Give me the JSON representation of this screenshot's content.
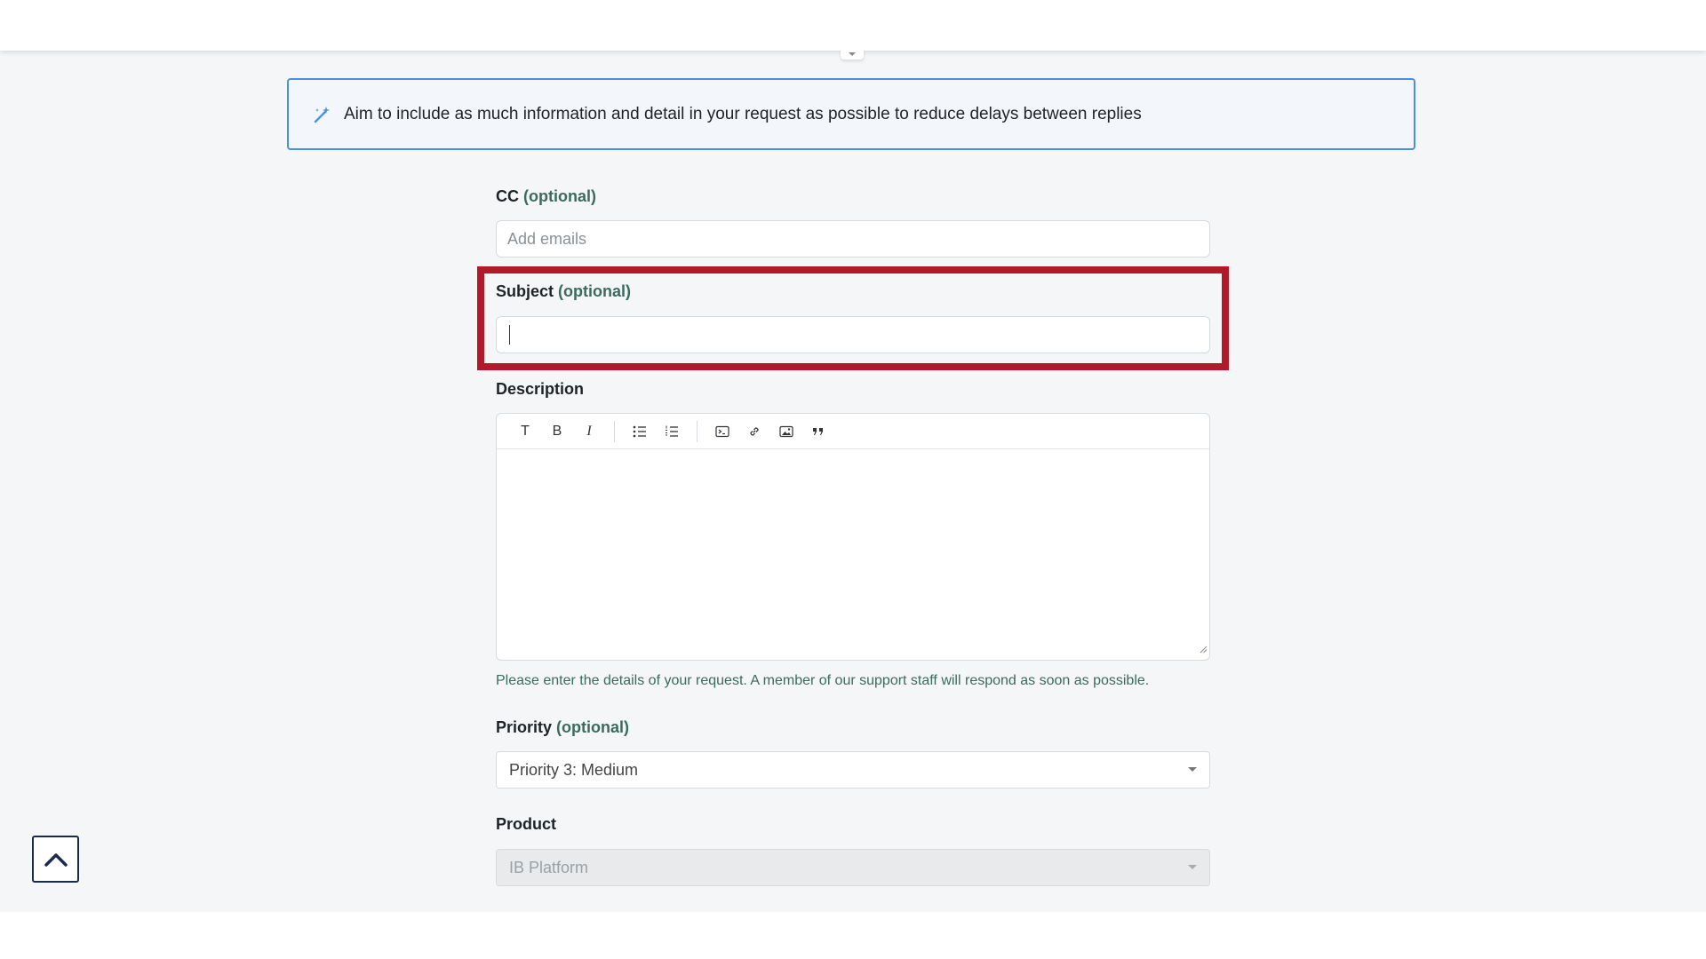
{
  "info_banner": {
    "icon": "magic-wand-icon",
    "text": "Aim to include as much information and detail in your request as possible to reduce delays between replies"
  },
  "cc": {
    "label": "CC",
    "optional": "(optional)",
    "placeholder": "Add emails"
  },
  "subject": {
    "label": "Subject",
    "optional": "(optional)",
    "value": ""
  },
  "description": {
    "label": "Description",
    "toolbar": [
      "text-style-icon",
      "bold-icon",
      "italic-icon",
      "bulleted-list-icon",
      "numbered-list-icon",
      "code-block-icon",
      "link-icon",
      "image-icon",
      "quote-icon"
    ],
    "toolbar_labels": {
      "text": "T",
      "bold": "B",
      "italic": "I"
    },
    "help": "Please enter the details of your request. A member of our support staff will respond as soon as possible."
  },
  "priority": {
    "label": "Priority",
    "optional": "(optional)",
    "value": "Priority 3: Medium"
  },
  "product": {
    "label": "Product",
    "value": "IB Platform"
  },
  "colors": {
    "highlight": "#b21a2a",
    "banner_border": "#4a90e2",
    "optional_text": "#3b6b5c"
  }
}
